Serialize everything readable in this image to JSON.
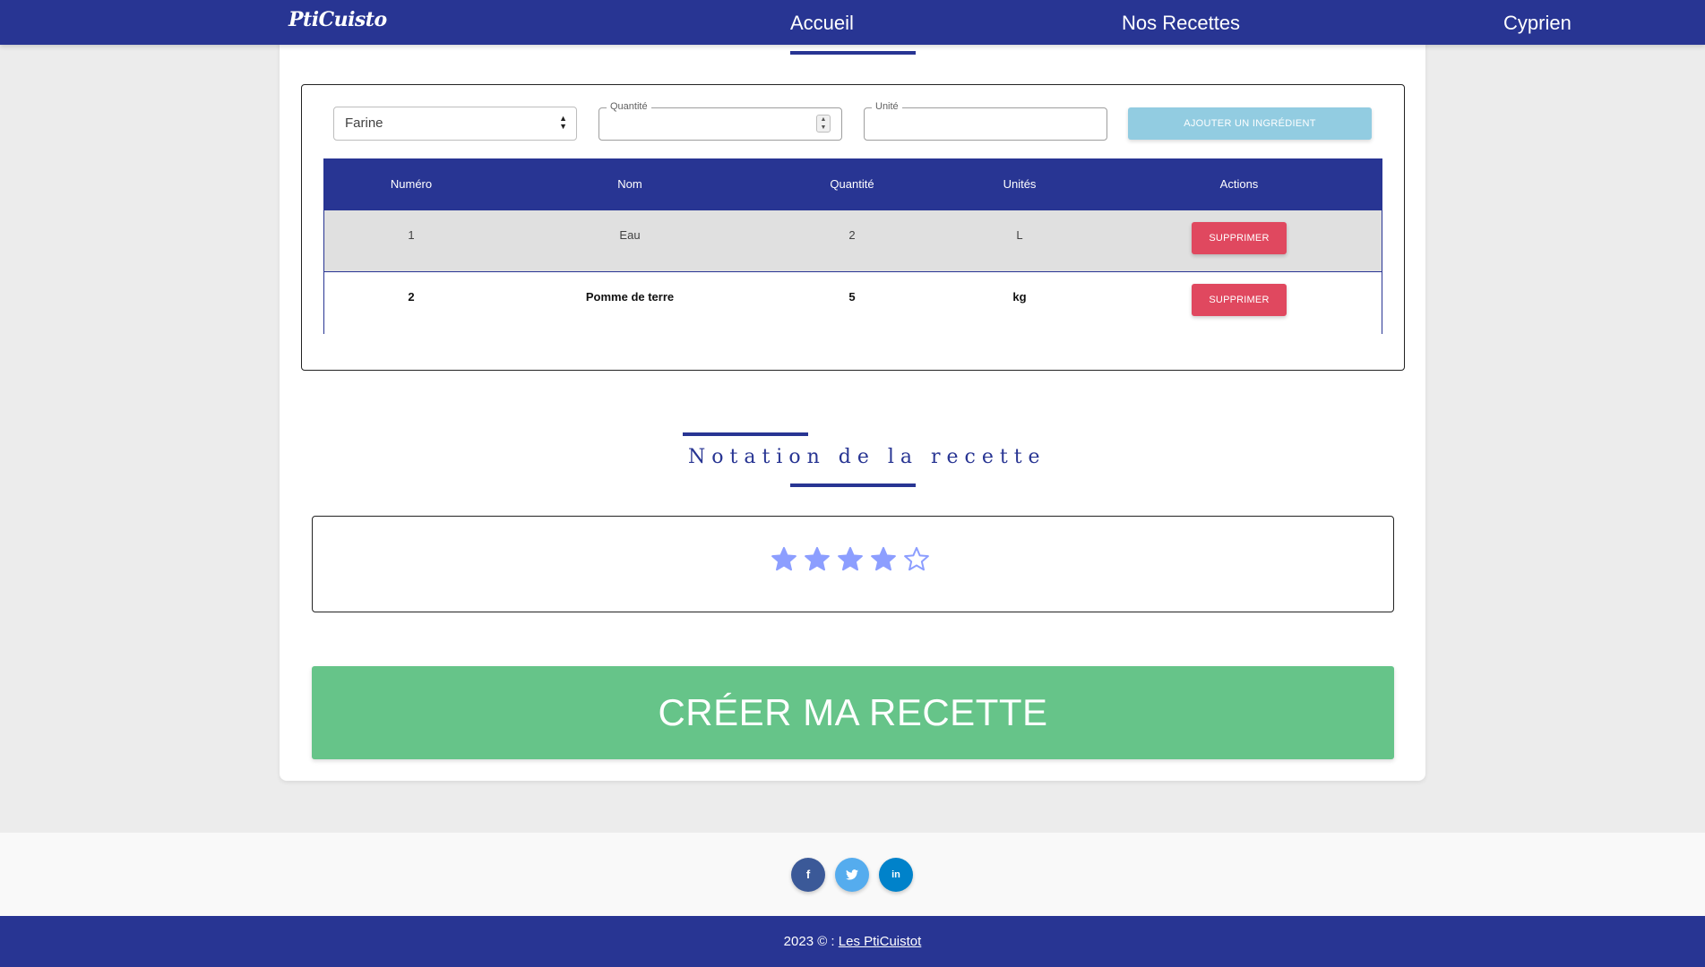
{
  "navbar": {
    "brand": "PtiCuisto",
    "links": [
      {
        "label": "Accueil"
      },
      {
        "label": "Nos Recettes"
      },
      {
        "label": "Cyprien"
      }
    ]
  },
  "ingredient_form": {
    "selected_ingredient": "Farine",
    "quantity_label": "Quantité",
    "quantity_value": "",
    "unit_label": "Unité",
    "unit_value": "",
    "add_button": "AJOUTER UN INGRÉDIENT"
  },
  "table": {
    "headers": [
      "Numéro",
      "Nom",
      "Quantité",
      "Unités",
      "Actions"
    ],
    "rows": [
      {
        "numero": "1",
        "nom": "Eau",
        "quantite": "2",
        "unite": "L",
        "action": "SUPPRIMER"
      },
      {
        "numero": "2",
        "nom": "Pomme de terre",
        "quantite": "5",
        "unite": "kg",
        "action": "SUPPRIMER"
      }
    ]
  },
  "rating": {
    "title": "Notation de la recette",
    "value": 4,
    "max": 5,
    "star_color": "#8c9eff"
  },
  "create_button": "CRÉER MA RECETTE",
  "social": {
    "icons": [
      "facebook-icon",
      "twitter-icon",
      "linkedin-icon"
    ],
    "facebook_glyph": "f",
    "linkedin_glyph": "in"
  },
  "footer": {
    "copyright": "2023 © : ",
    "link": "Les PtiCuistot"
  },
  "colors": {
    "primary": "#283593",
    "danger": "#e0485f",
    "success": "#66c489",
    "info": "#92cce1"
  }
}
